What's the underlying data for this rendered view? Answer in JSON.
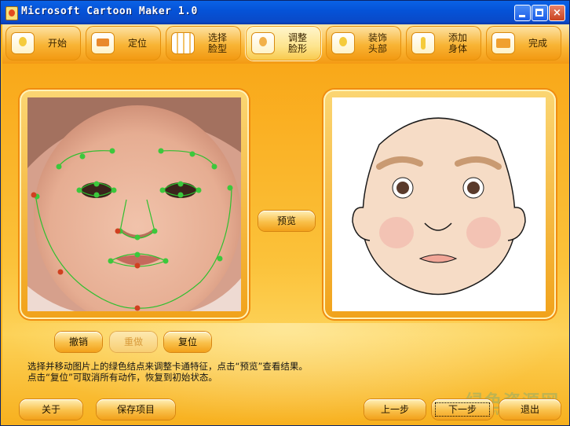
{
  "window": {
    "title": "Microsoft Cartoon Maker 1.0",
    "minimize": "_",
    "maximize": "□",
    "close": "×"
  },
  "tabs": [
    {
      "label": "开始",
      "icon": "start-icon"
    },
    {
      "label": "定位",
      "icon": "locate-icon"
    },
    {
      "label": "选择\n脸型",
      "icon": "face-grid-icon"
    },
    {
      "label": "调整\n脸形",
      "icon": "adjust-face-icon",
      "active": true
    },
    {
      "label": "装饰\n头部",
      "icon": "decorate-head-icon"
    },
    {
      "label": "添加\n身体",
      "icon": "add-body-icon"
    },
    {
      "label": "完成",
      "icon": "finish-icon"
    }
  ],
  "editor": {
    "preview_button": "预览",
    "undo_button": "撤销",
    "redo_button": "重做",
    "reset_button": "复位"
  },
  "instructions": {
    "line1": "选择并移动图片上的绿色结点来调整卡通特征，点击“预览”查看结果。",
    "line2": "点击“复位”可取消所有动作，恢复到初始状态。"
  },
  "footer": {
    "about_button": "关于",
    "save_button": "保存项目",
    "prev_button": "上一步",
    "next_button": "下一步",
    "exit_button": "退出"
  },
  "watermark": {
    "text": "绿色资源网",
    "url": "www.downcc.com"
  },
  "colors": {
    "accent": "#f7b21c",
    "node_green": "#3cc83c",
    "node_red": "#d04020",
    "title_blue": "#0553d8"
  }
}
